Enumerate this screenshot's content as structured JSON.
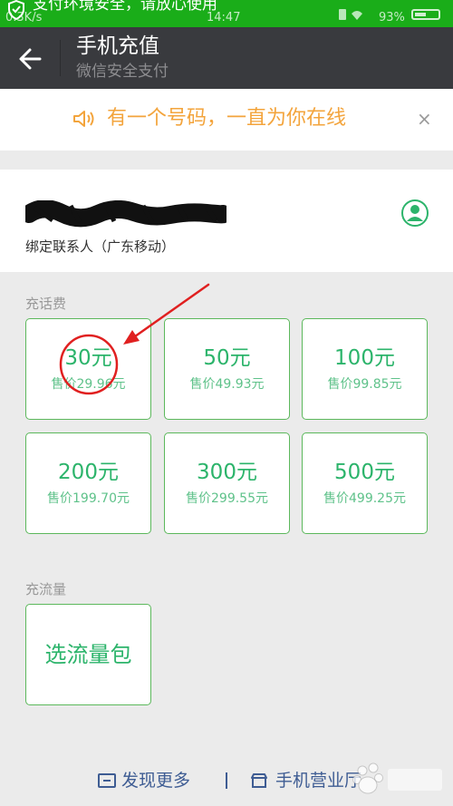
{
  "status_bar": {
    "banner_text": "支付环境安全，请放心使用",
    "network_speed": "0.3K/s",
    "time": "14:47",
    "battery": "93%"
  },
  "header": {
    "title": "手机充值",
    "subtitle": "微信安全支付"
  },
  "notice": {
    "text": "有一个号码，一直为你在线",
    "close_label": "×"
  },
  "contact": {
    "label": "绑定联系人（广东移动）"
  },
  "recharge": {
    "title": "充话费",
    "options": [
      {
        "amount": "30元",
        "price": "售价29.96元"
      },
      {
        "amount": "50元",
        "price": "售价49.93元"
      },
      {
        "amount": "100元",
        "price": "售价99.85元"
      },
      {
        "amount": "200元",
        "price": "售价199.70元"
      },
      {
        "amount": "300元",
        "price": "售价299.55元"
      },
      {
        "amount": "500元",
        "price": "售价499.25元"
      }
    ]
  },
  "data_plan": {
    "title": "充流量",
    "button_label": "选流量包"
  },
  "footer": {
    "discover_label": "发现更多",
    "store_label": "手机营业厅"
  },
  "colors": {
    "banner_green": "#1aad19",
    "header_bg": "#393a3e",
    "accent_green": "#2cb46b",
    "notice_orange": "#f3a43c",
    "footer_link": "#3e5c93",
    "annotation_red": "#e02020"
  }
}
